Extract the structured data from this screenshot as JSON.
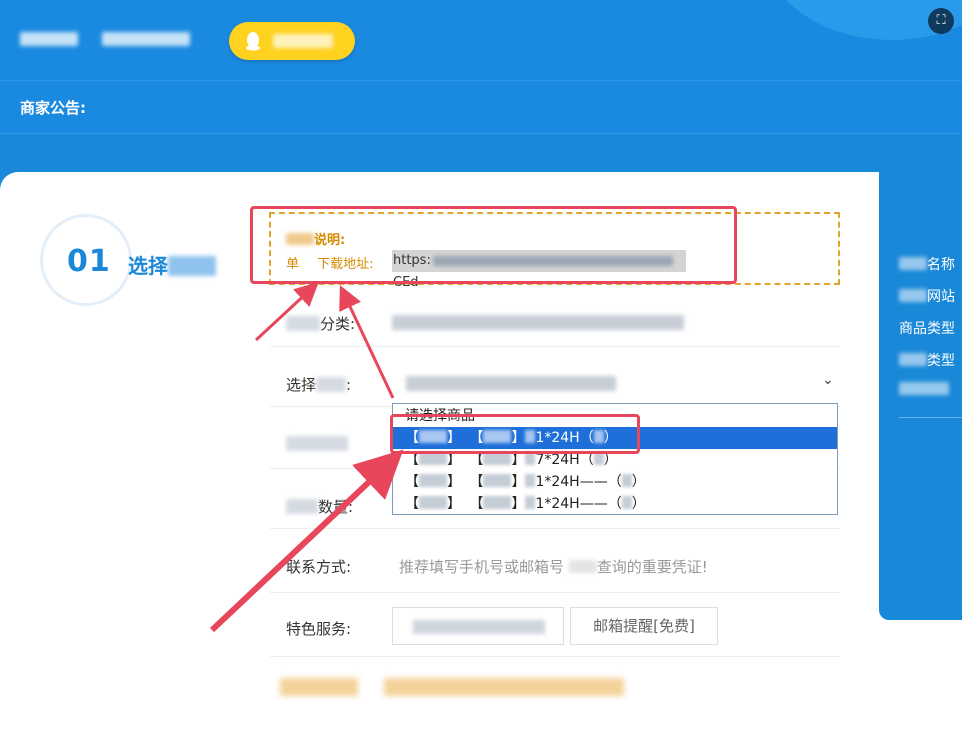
{
  "header": {
    "notice_label": "商家公告:",
    "fullscreen_icon": "fullscreen-exit-icon",
    "qq_icon": "qq-penguin-icon"
  },
  "step": {
    "number": "01",
    "title_prefix": "选择"
  },
  "description": {
    "title_suffix": "说明:",
    "prefix_char": "单",
    "download_label": "下载地址:",
    "url_start": "https:",
    "url_end": "CEd"
  },
  "form": {
    "category_label_suffix": "分类:",
    "select_label_prefix": "选择",
    "select_label_suffix": ":",
    "select_arrow_icon": "chevron-down-icon",
    "quantity_label_suffix": "数量:",
    "contact_label": "联系方式:",
    "contact_placeholder_a": "推荐填写手机号或邮箱号",
    "contact_placeholder_b": "查询的重要凭证!",
    "service_label": "特色服务:",
    "email_reminder_button": "邮箱提醒[免费]"
  },
  "dropdown": {
    "placeholder": "请选择商品",
    "items": [
      {
        "open": "【",
        "close": "】",
        "suffix": "1*24H（",
        "end": "）",
        "selected": true
      },
      {
        "open": "【",
        "close": "】",
        "suffix": "7*24H（",
        "end": "）",
        "selected": false
      },
      {
        "open": "【",
        "close": "】",
        "suffix": "1*24H——（",
        "end": "）",
        "selected": false
      },
      {
        "open": "【",
        "close": "】",
        "suffix": "1*24H——（",
        "end": "）",
        "selected": false
      }
    ]
  },
  "right_panel": {
    "items": [
      "名称",
      "网站",
      "商品类型",
      "类型"
    ]
  },
  "colors": {
    "brand_blue": "#1a88d8",
    "accent_yellow": "#ffd21f",
    "notice_orange": "#d68a00",
    "annotation_red": "#e8465b",
    "selected_blue": "#1e6fd9"
  }
}
